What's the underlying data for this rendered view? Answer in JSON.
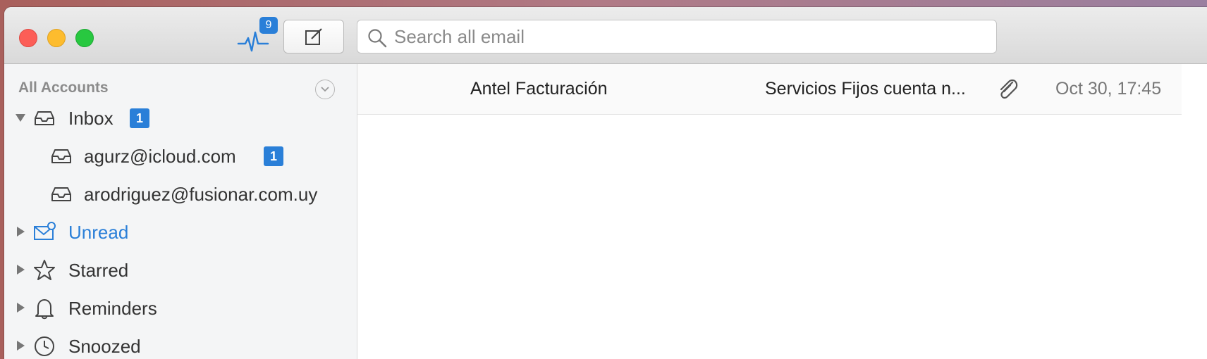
{
  "toolbar": {
    "activity_badge": "9",
    "search_placeholder": "Search all email"
  },
  "sidebar": {
    "header": "All Accounts",
    "items": [
      {
        "label": "Inbox",
        "count": "1",
        "icon": "inbox-icon",
        "expanded": true
      },
      {
        "label": "agurz@icloud.com",
        "count": "1",
        "icon": "inbox-icon"
      },
      {
        "label": "arodriguez@fusionar.com.uy",
        "icon": "inbox-icon"
      },
      {
        "label": "Unread",
        "icon": "unread-mail-icon",
        "highlight_color": "#2a7fd8"
      },
      {
        "label": "Starred",
        "icon": "star-icon"
      },
      {
        "label": "Reminders",
        "icon": "bell-icon"
      },
      {
        "label": "Snoozed",
        "icon": "clock-icon"
      }
    ]
  },
  "messages": [
    {
      "from": "Antel Facturación",
      "subject": "Servicios Fijos cuenta n...",
      "has_attachment": true,
      "date": "Oct 30, 17:45"
    }
  ],
  "colors": {
    "accent": "#2a7fd8",
    "close": "#fc5e57",
    "minimize": "#fdbc2e",
    "zoom": "#28c840"
  }
}
